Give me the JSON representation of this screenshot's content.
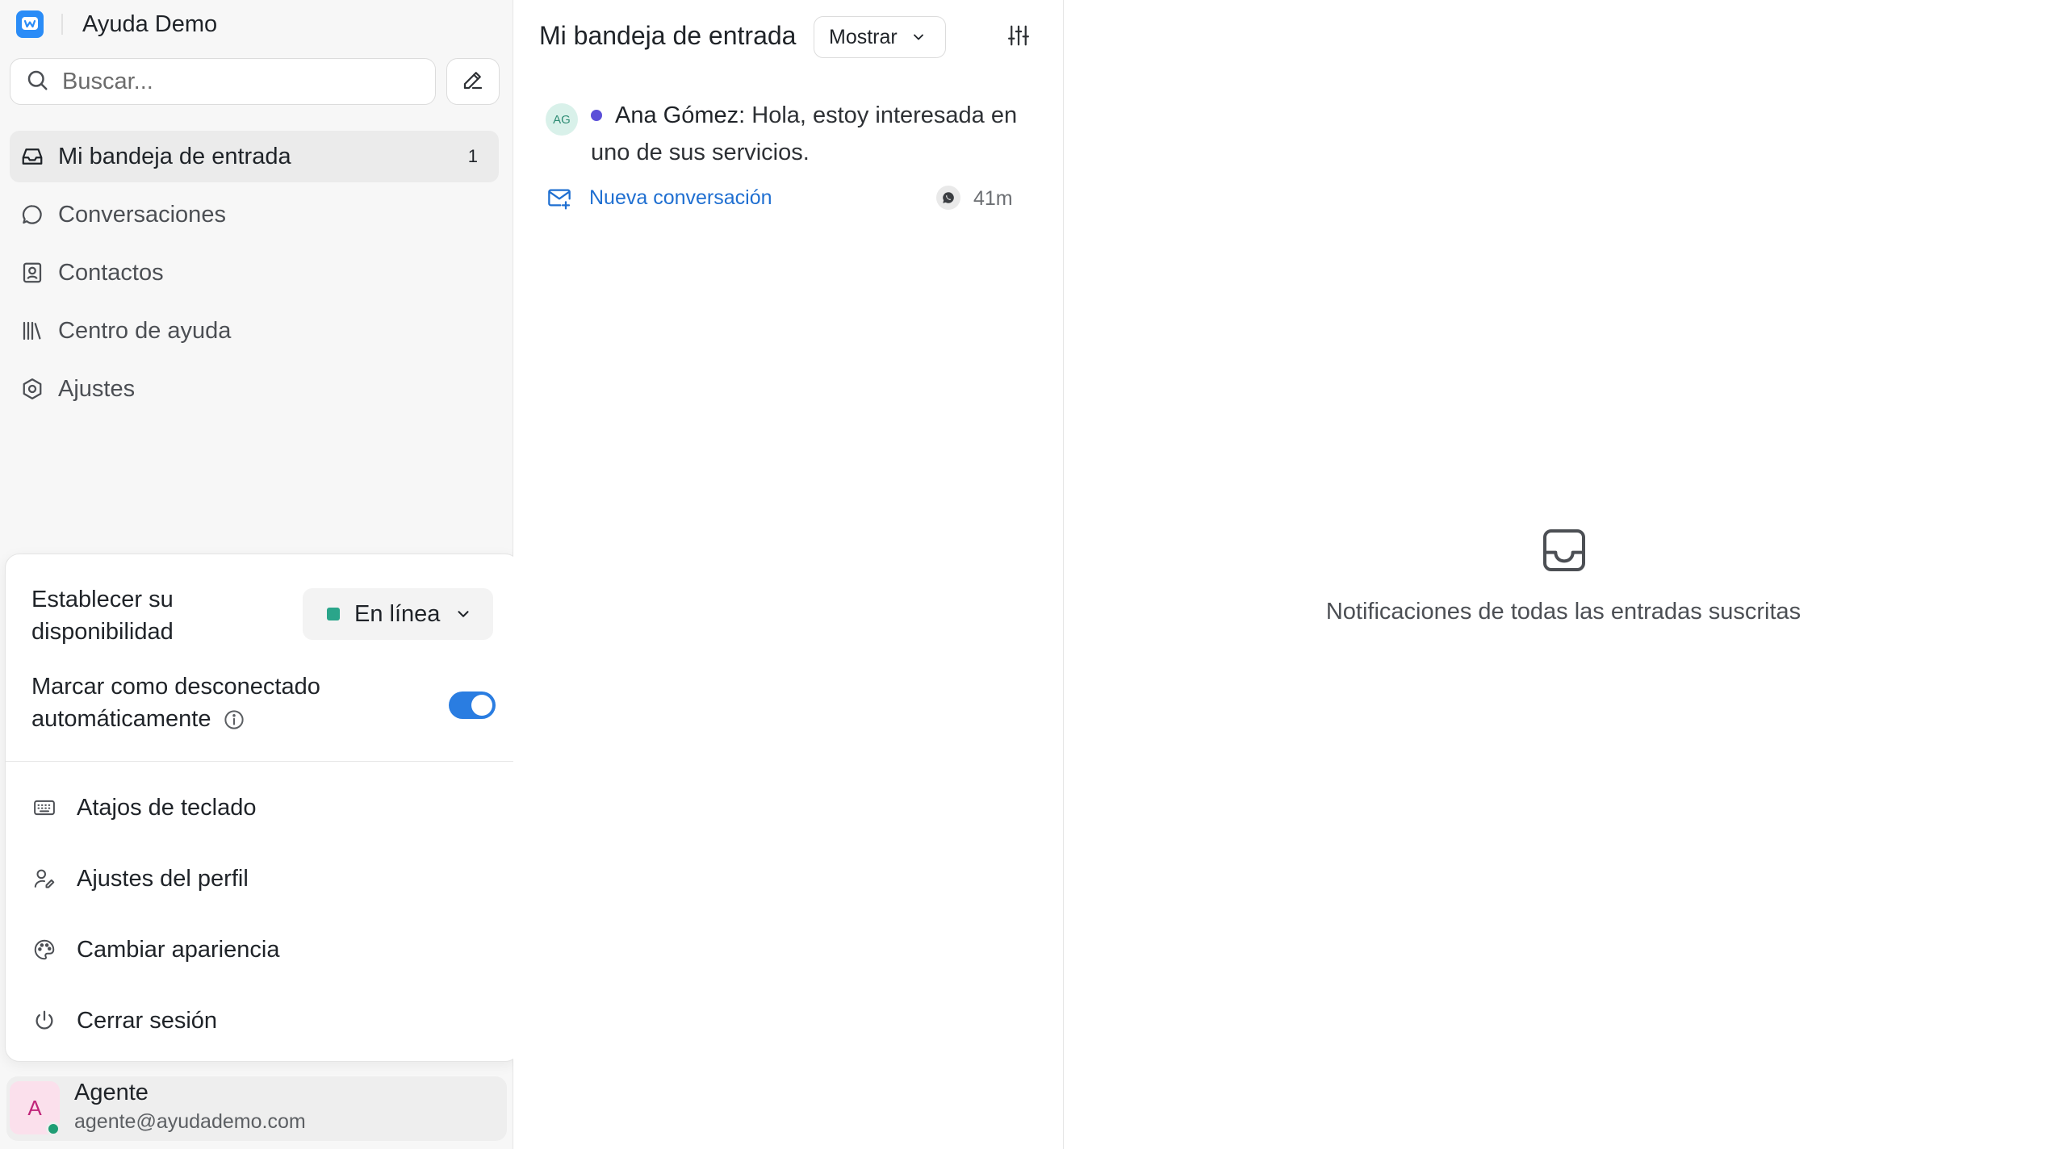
{
  "app": {
    "brand_name": "Ayuda Demo",
    "accent_color": "#2a7de1"
  },
  "sidebar": {
    "search_placeholder": "Buscar...",
    "nav": [
      {
        "label": "Mi bandeja de entrada",
        "badge": "1",
        "icon": "inbox-icon",
        "active": true
      },
      {
        "label": "Conversaciones",
        "icon": "chat-bubble-icon"
      },
      {
        "label": "Contactos",
        "icon": "contact-card-icon"
      },
      {
        "label": "Centro de ayuda",
        "icon": "library-icon"
      },
      {
        "label": "Ajustes",
        "icon": "settings-icon"
      }
    ]
  },
  "profile_menu": {
    "availability_label": "Establecer su disponibilidad",
    "status_value": "En línea",
    "status_color": "#2aa58a",
    "auto_offline_label": "Marcar como desconectado automáticamente",
    "auto_offline_enabled": true,
    "items": [
      {
        "label": "Atajos de teclado",
        "icon": "keyboard-icon"
      },
      {
        "label": "Ajustes del perfil",
        "icon": "user-edit-icon"
      },
      {
        "label": "Cambiar apariencia",
        "icon": "palette-icon"
      },
      {
        "label": "Cerrar sesión",
        "icon": "power-icon"
      }
    ]
  },
  "user": {
    "initial": "A",
    "name": "Agente",
    "email": "agente@ayudademo.com"
  },
  "inbox": {
    "title": "Mi bandeja de entrada",
    "show_button": "Mostrar",
    "conversations": [
      {
        "avatar_initials": "AG",
        "sender": "Ana Gómez:",
        "message": " Hola, estoy interesada en uno de sus servicios.",
        "status_label": "Nueva conversación",
        "channel_icon": "whatsapp-icon",
        "time": "41m",
        "unread": true
      }
    ]
  },
  "main": {
    "empty_message": "Notificaciones de todas las entradas suscritas"
  }
}
